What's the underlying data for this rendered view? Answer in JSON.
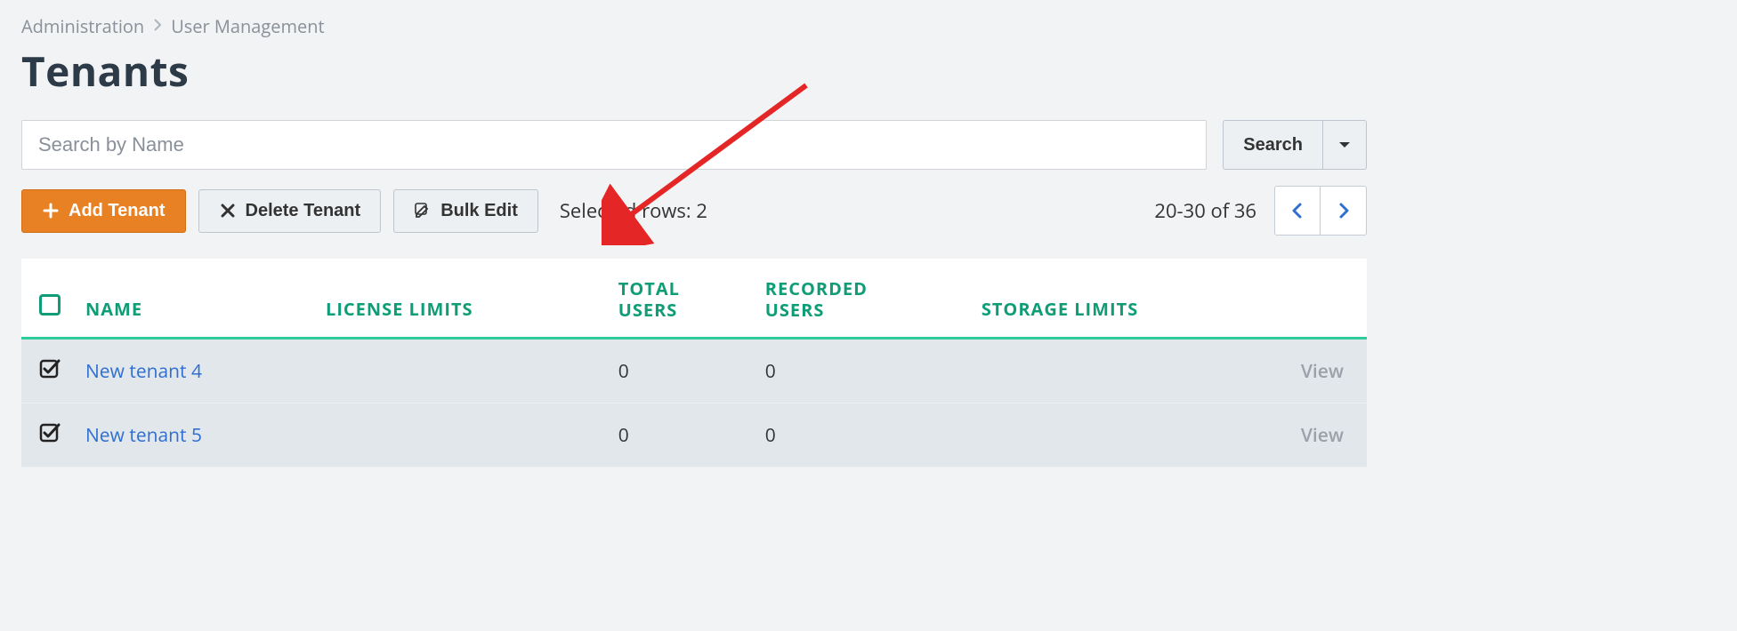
{
  "breadcrumb": {
    "items": [
      "Administration",
      "User Management"
    ]
  },
  "page": {
    "title": "Tenants"
  },
  "search": {
    "placeholder": "Search by Name",
    "button_label": "Search"
  },
  "toolbar": {
    "add_label": "Add Tenant",
    "delete_label": "Delete Tenant",
    "bulk_edit_label": "Bulk Edit",
    "selected_text": "Selected rows: 2"
  },
  "pagination": {
    "range_text": "20-30 of 36"
  },
  "table": {
    "columns": {
      "name": "NAME",
      "license_limits": "LICENSE LIMITS",
      "total_users": "TOTAL USERS",
      "recorded_users": "RECORDED USERS",
      "storage_limits": "STORAGE LIMITS"
    },
    "view_label": "View",
    "rows": [
      {
        "checked": true,
        "name": "New tenant 4",
        "license_limits": "",
        "total_users": "0",
        "recorded_users": "0",
        "storage_limits": ""
      },
      {
        "checked": true,
        "name": "New tenant 5",
        "license_limits": "",
        "total_users": "0",
        "recorded_users": "0",
        "storage_limits": ""
      }
    ]
  }
}
